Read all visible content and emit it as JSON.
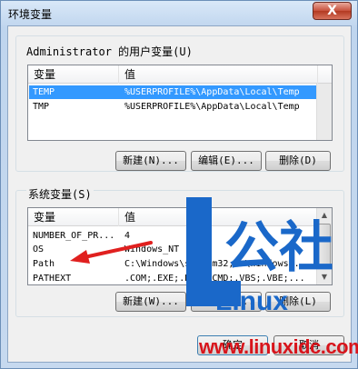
{
  "window": {
    "title": "环境变量",
    "close_glyph": "X"
  },
  "user_vars": {
    "group_label": "Administrator 的用户变量(U)",
    "columns": [
      "变量",
      "值"
    ],
    "rows": [
      {
        "name": "TEMP",
        "value": "%USERPROFILE%\\AppData\\Local\\Temp",
        "selected": true
      },
      {
        "name": "TMP",
        "value": "%USERPROFILE%\\AppData\\Local\\Temp",
        "selected": false
      }
    ],
    "buttons": {
      "new": "新建(N)...",
      "edit": "编辑(E)...",
      "delete": "删除(D)"
    }
  },
  "system_vars": {
    "group_label": "系统变量(S)",
    "columns": [
      "变量",
      "值"
    ],
    "rows": [
      {
        "name": "NUMBER_OF_PR...",
        "value": "4"
      },
      {
        "name": "OS",
        "value": "Windows_NT"
      },
      {
        "name": "Path",
        "value": "C:\\Windows\\system32;C:\\Windows..."
      },
      {
        "name": "PATHEXT",
        "value": ".COM;.EXE;.BAT;.CMD;.VBS;.VBE;..."
      }
    ],
    "buttons": {
      "new": "新建(W)...",
      "edit": "编辑(I)...",
      "delete": "删除(L)"
    }
  },
  "footer": {
    "ok": "确定",
    "cancel": "取消"
  },
  "watermark": {
    "site": "www.linuxidc.com",
    "logo_chars": "公社",
    "logo_word": "Linux"
  },
  "colors": {
    "selection": "#3399ff",
    "arrow": "#e0201f",
    "logo_blue": "#1a68c9"
  }
}
